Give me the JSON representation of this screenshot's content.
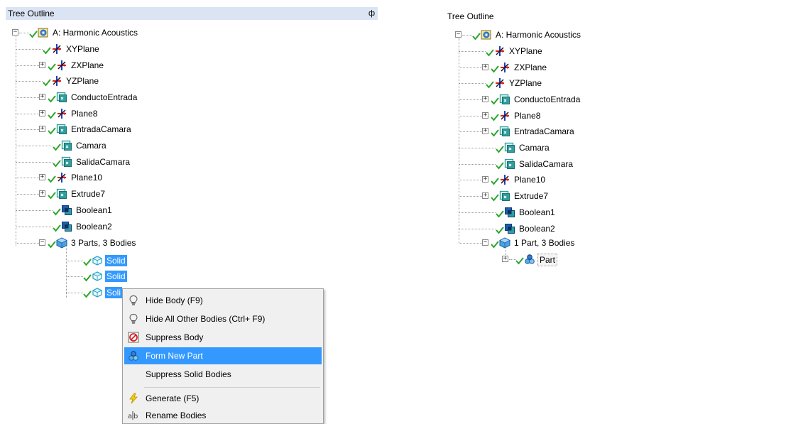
{
  "left": {
    "title": "Tree Outline",
    "pin_glyph": "ф",
    "root": "A: Harmonic Acoustics",
    "items": [
      "XYPlane",
      "ZXPlane",
      "YZPlane",
      "ConductoEntrada",
      "Plane8",
      "EntradaCamara",
      "Camara",
      "SalidaCamara",
      "Plane10",
      "Extrude7",
      "Boolean1",
      "Boolean2",
      "3 Parts, 3 Bodies"
    ],
    "solids": [
      "Solid",
      "Solid",
      "Soli"
    ]
  },
  "menu": {
    "hide_body": "Hide Body (F9)",
    "hide_all": "Hide All Other Bodies (Ctrl+ F9)",
    "suppress_body": "Suppress Body",
    "form_new_part": "Form New Part",
    "suppress_solid": "Suppress Solid Bodies",
    "generate": "Generate (F5)",
    "rename": "Rename Bodies"
  },
  "right": {
    "title": "Tree Outline",
    "root": "A: Harmonic Acoustics",
    "items": [
      "XYPlane",
      "ZXPlane",
      "YZPlane",
      "ConductoEntrada",
      "Plane8",
      "EntradaCamara",
      "Camara",
      "SalidaCamara",
      "Plane10",
      "Extrude7",
      "Boolean1",
      "Boolean2",
      "1 Part, 3 Bodies"
    ],
    "part": "Part"
  },
  "colors": {
    "title_bar": "#dbe4f3",
    "selection": "#3399ff",
    "check": "#2aa62a",
    "plane_red": "#e02020",
    "plane_blue": "#1f3fbf",
    "feature_teal": "#2e9e9e",
    "boolean_blue": "#1d5fae"
  }
}
